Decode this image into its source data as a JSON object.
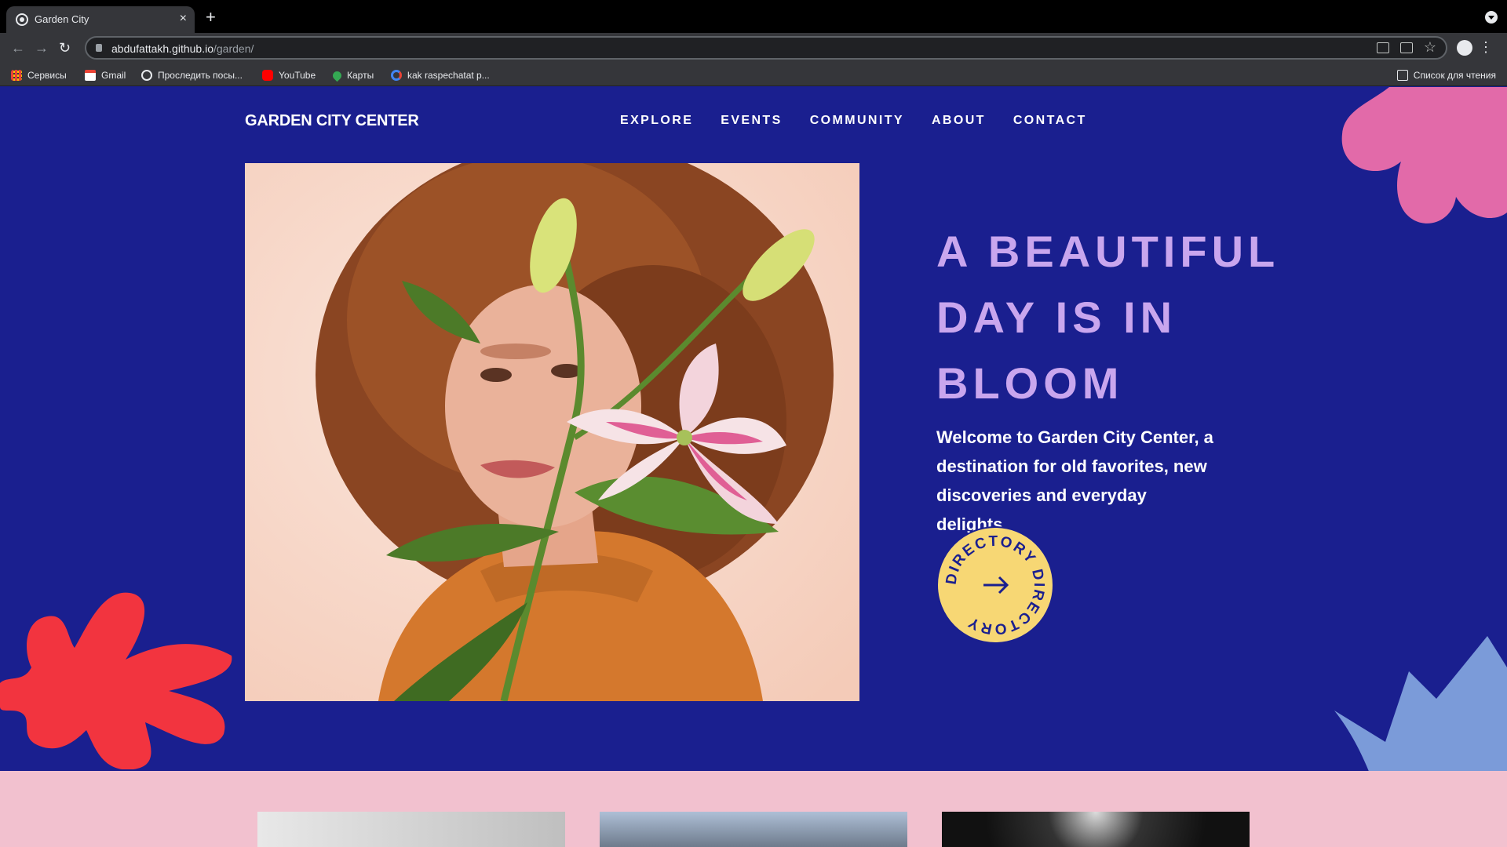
{
  "browser": {
    "tab_title": "Garden City",
    "tab_close": "×",
    "new_tab": "+",
    "url_host": "abdufattakh.github.io",
    "url_path": "/garden/",
    "bookmarks": [
      {
        "label": "Сервисы",
        "icon": "apps-icon"
      },
      {
        "label": "Gmail",
        "icon": "gmail-icon"
      },
      {
        "label": "Проследить посы...",
        "icon": "globe-icon"
      },
      {
        "label": "YouTube",
        "icon": "youtube-icon"
      },
      {
        "label": "Карты",
        "icon": "maps-icon"
      },
      {
        "label": "kak raspechatat p...",
        "icon": "google-icon"
      }
    ],
    "reading_list": "Список для чтения"
  },
  "site": {
    "logo": "GARDEN CITY CENTER",
    "nav": [
      "EXPLORE",
      "EVENTS",
      "COMMUNITY",
      "ABOUT",
      "CONTACT"
    ],
    "headline": "A BEAUTIFUL DAY IS IN BLOOM",
    "welcome": "Welcome to Garden City Center, a destination for old favorites, new discoveries and everyday delights.",
    "directory_label": "DIRECTORY DIRECTORY"
  },
  "colors": {
    "background": "#1a1f8f",
    "headline": "#c9a6ee",
    "directory_badge": "#f7d774",
    "pink_blob": "#e26aa9",
    "red_blob": "#f2343f",
    "blue_blob": "#7b9bd9",
    "section_band": "#f2c1cf"
  }
}
